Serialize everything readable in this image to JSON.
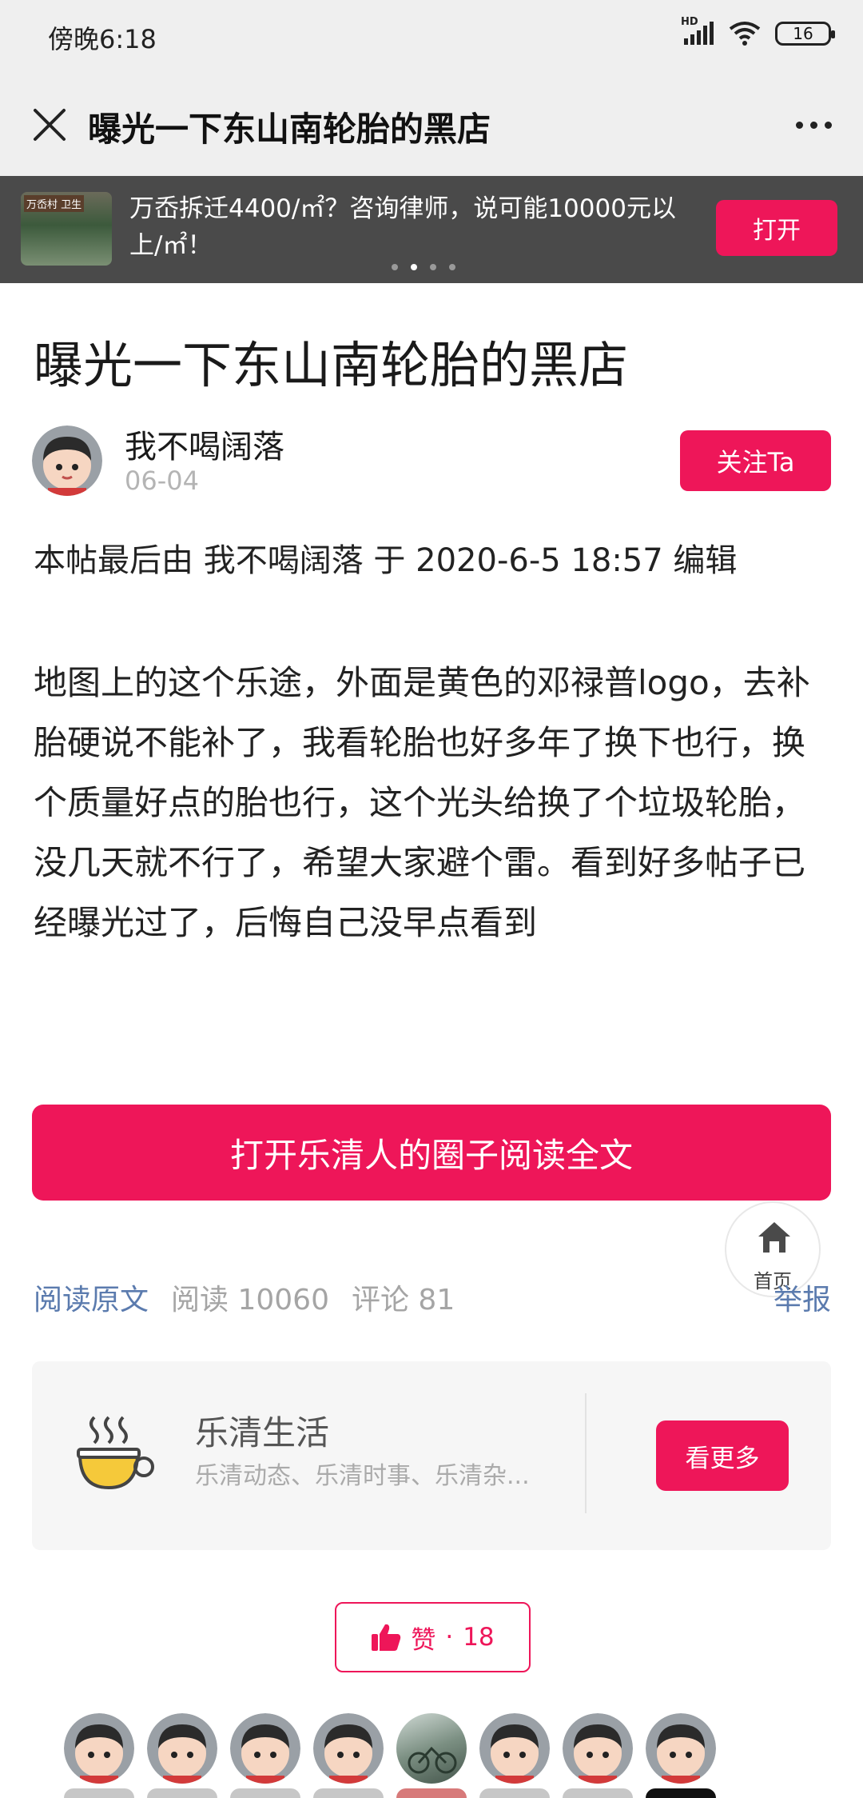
{
  "status_bar": {
    "time": "傍晚6:18",
    "network_label": "HD",
    "battery": "16"
  },
  "header": {
    "title": "曝光一下东山南轮胎的黑店"
  },
  "ad_banner": {
    "thumb_label": "万岙村 卫生",
    "text": "万岙拆迁4400/㎡？咨询律师，说可能10000元以上/㎡！",
    "open_label": "打开"
  },
  "article": {
    "title": "曝光一下东山南轮胎的黑店",
    "author": "我不喝阔落",
    "date": "06-04",
    "follow_label": "关注Ta",
    "edit_note": "本帖最后由 我不喝阔落 于 2020-6-5 18:57 编辑",
    "body": "地图上的这个乐途，外面是黄色的邓禄普logo，去补胎硬说不能补了，我看轮胎也好多年了换下也行，换个质量好点的胎也行，这个光头给换了个垃圾轮胎，没几天就不行了，希望大家避个雷。看到好多帖子已经曝光过了，后悔自己没早点看到",
    "read_full_label": "打开乐清人的圈子阅读全文"
  },
  "home_button": {
    "label": "首页"
  },
  "meta": {
    "original_link": "阅读原文",
    "reads": "阅读 10060",
    "comments": "评论 81",
    "report": "举报"
  },
  "community_card": {
    "name": "乐清生活",
    "desc": "乐清动态、乐清时事、乐清杂...",
    "more_label": "看更多"
  },
  "like": {
    "label": "赞",
    "separator": "·",
    "count": "18"
  },
  "colors": {
    "accent": "#ee1659",
    "link": "#5b7bae",
    "muted": "#a5a5a5"
  },
  "icons": [
    "close-icon",
    "more-icon",
    "home-icon",
    "teacup-icon",
    "thumbs-up-icon",
    "signal-icon",
    "wifi-icon",
    "battery-icon"
  ]
}
